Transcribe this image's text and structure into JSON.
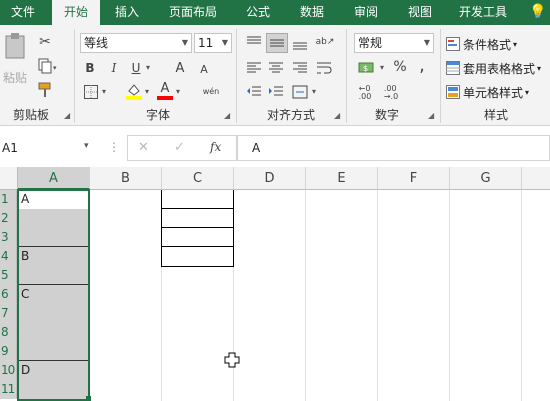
{
  "tabs": [
    "文件",
    "开始",
    "插入",
    "页面布局",
    "公式",
    "数据",
    "审阅",
    "视图",
    "开发工具"
  ],
  "tab_hint_icon": "lightbulb-icon",
  "clipboard": {
    "paste_label": "粘贴",
    "group_label": "剪贴板"
  },
  "font": {
    "name": "等线",
    "size": "11",
    "group_label": "字体",
    "bold": "B",
    "italic": "I",
    "underline": "U",
    "grow": "A",
    "shrink": "A",
    "font_color_glyph": "A",
    "wen": "wén"
  },
  "alignment": {
    "group_label": "对齐方式"
  },
  "number": {
    "format": "常规",
    "group_label": "数字",
    "percent": "%",
    "comma": ","
  },
  "styles": {
    "conditional": "条件格式",
    "table": "套用表格格式",
    "cell": "单元格样式",
    "group_label": "样式"
  },
  "formula_bar": {
    "name_box": "A1",
    "fx": "fx",
    "value": "A"
  },
  "columns": [
    "A",
    "B",
    "C",
    "D",
    "E",
    "F",
    "G"
  ],
  "rows": [
    "1",
    "2",
    "3",
    "4",
    "5",
    "6",
    "7",
    "8",
    "9",
    "10",
    "11"
  ],
  "cells": {
    "A1": "A",
    "A4": "B",
    "A6": "C",
    "A10": "D"
  },
  "colors": {
    "excel_green": "#217346",
    "selection_fill": "#d0d0d0",
    "highlight_yellow": "#ffff00",
    "font_red": "#ff0000"
  }
}
